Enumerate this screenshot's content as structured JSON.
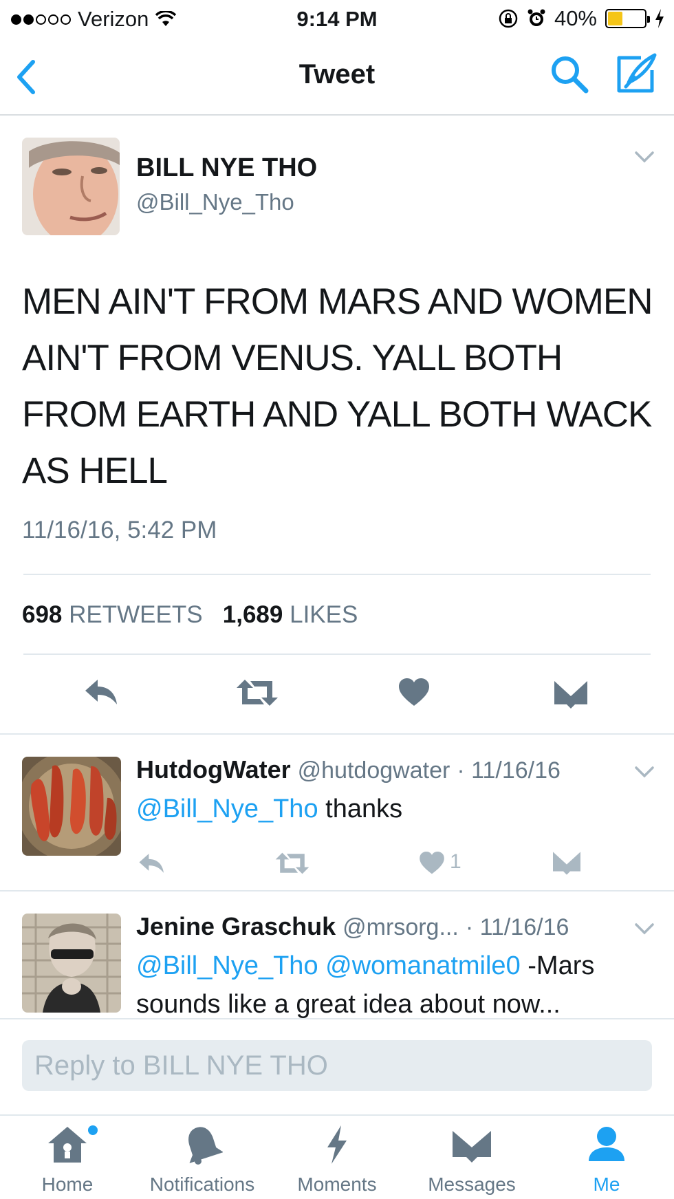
{
  "status_bar": {
    "carrier": "Verizon",
    "time": "9:14 PM",
    "battery": "40%",
    "battery_level": 0.4
  },
  "nav": {
    "title": "Tweet",
    "back_icon": "chevron-left-icon",
    "search_icon": "search-icon",
    "compose_icon": "compose-icon"
  },
  "tweet": {
    "author_name": "BILL NYE THO",
    "author_handle": "@Bill_Nye_Tho",
    "text": "MEN AIN'T FROM MARS AND WOMEN AIN'T FROM VENUS. YALL BOTH FROM EARTH AND YALL BOTH WACK AS HELL",
    "timestamp": "11/16/16, 5:42 PM",
    "retweets_count": "698",
    "retweets_label": "RETWEETS",
    "likes_count": "1,689",
    "likes_label": "LIKES"
  },
  "replies": [
    {
      "name": "HutdogWater",
      "handle": "@hutdogwater",
      "date": "· 11/16/16",
      "mention": "@Bill_Nye_Tho",
      "text": " thanks",
      "like_count": "1"
    },
    {
      "name": "Jenine Graschuk",
      "handle": "@mrsorg...",
      "date": "· 11/16/16",
      "mention": "@Bill_Nye_Tho @womanatmile0",
      "text": " -Mars sounds like a great idea about now..."
    }
  ],
  "compose": {
    "placeholder": "Reply to BILL NYE THO"
  },
  "tabs": [
    {
      "label": "Home",
      "icon": "home-icon"
    },
    {
      "label": "Notifications",
      "icon": "bell-icon"
    },
    {
      "label": "Moments",
      "icon": "lightning-icon"
    },
    {
      "label": "Messages",
      "icon": "envelope-icon"
    },
    {
      "label": "Me",
      "icon": "person-icon"
    }
  ],
  "colors": {
    "accent": "#1da1f2",
    "secondary_text": "#657786",
    "action_icon_dark": "#657786",
    "action_icon_light": "#aab8c2",
    "battery_fill": "#f5c518"
  }
}
